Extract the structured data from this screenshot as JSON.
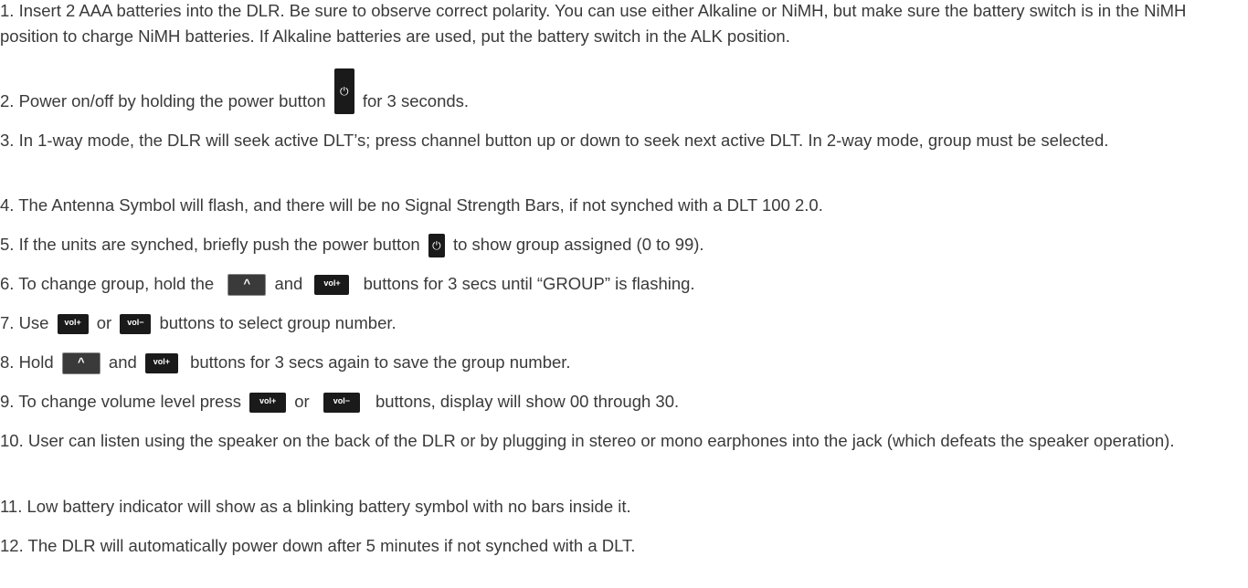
{
  "steps": {
    "s1": "1. Insert 2 AAA batteries into the DLR. Be sure to observe correct polarity.  You can use either Alkaline or NiMH, but make sure the battery switch is in the NiMH position to charge NiMH batteries.  If Alkaline batteries are used, put the battery switch in the ALK position.",
    "s2_a": "2. Power on/off by holding the power button",
    "s2_b": "for 3 seconds.",
    "s3": "3. In 1-way mode, the DLR will seek active DLT’s; press channel button up or down to seek next active DLT.  In 2-way mode, group must be selected.",
    "s4": "4. The Antenna Symbol will flash, and there will be no Signal Strength Bars, if not synched with a DLT 100 2.0.",
    "s5_a": "5. If the units are synched, briefly push the power button",
    "s5_b": "to show group assigned (0 to 99).",
    "s6_a": "6. To change group, hold the",
    "s6_b": "and",
    "s6_c": "buttons for 3 secs until “GROUP” is flashing.",
    "s7_a": "7. Use",
    "s7_b": "or",
    "s7_c": "buttons to select group number.",
    "s8_a": "8. Hold",
    "s8_b": "and",
    "s8_c": "buttons for 3 secs again to save the group number.",
    "s9_a": "9. To change volume level press",
    "s9_b": "or",
    "s9_c": "buttons, display will show 00 through 30.",
    "s10": "10. User can listen using the speaker on the back of the DLR or by plugging in stereo or mono earphones into the jack (which defeats the speaker operation).",
    "s11": "11. Low battery indicator will show as a blinking battery symbol with no bars inside it.",
    "s12": "12. The DLR will automatically power down after 5 minutes if not synched with a DLT."
  },
  "icons": {
    "power": "⏻",
    "up": "^",
    "vol_plus": "vol+",
    "vol_minus": "vol−"
  }
}
